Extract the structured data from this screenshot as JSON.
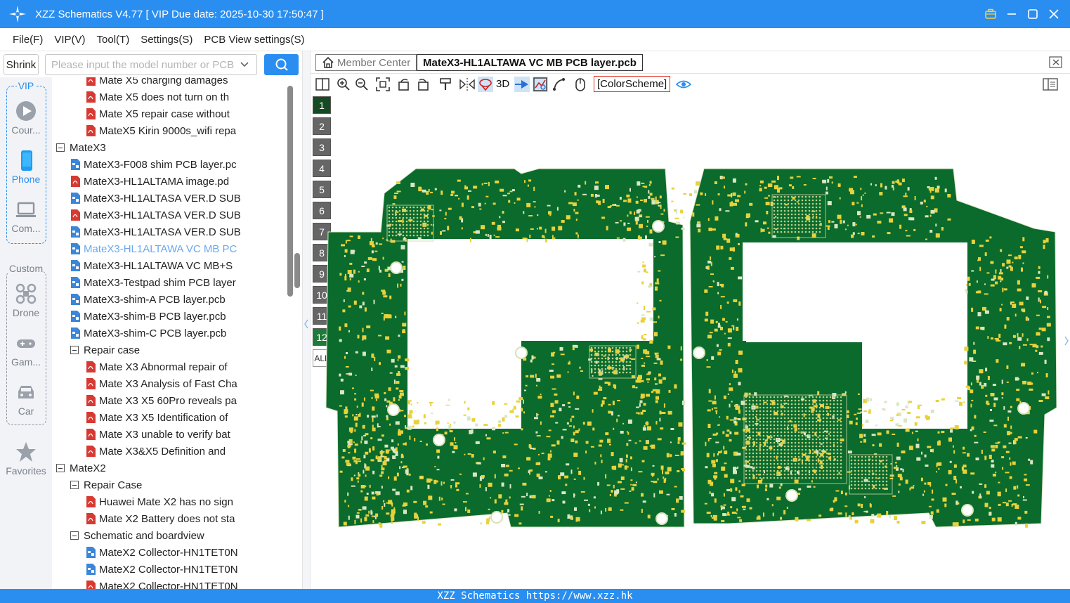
{
  "window": {
    "title": "XZZ Schematics V4.77 [ VIP Due date: 2025-10-30 17:50:47 ]"
  },
  "menu": [
    "File(F)",
    "VIP(V)",
    "Tool(T)",
    "Settings(S)",
    "PCB View settings(S)"
  ],
  "search": {
    "shrink_label": "Shrink",
    "placeholder": "Please input the model number or PCB"
  },
  "rail": {
    "vip_label": "VIP",
    "custom_label": "Custom",
    "items": [
      {
        "label": "Cour...",
        "icon": "play-icon"
      },
      {
        "label": "Phone",
        "icon": "phone-icon"
      },
      {
        "label": "Com...",
        "icon": "laptop-icon"
      },
      {
        "label": "Drone",
        "icon": "drone-icon"
      },
      {
        "label": "Gam...",
        "icon": "gamepad-icon"
      },
      {
        "label": "Car",
        "icon": "car-icon"
      },
      {
        "label": "Favorites",
        "icon": "star-icon"
      }
    ]
  },
  "tree": {
    "rows": [
      {
        "text": "Mate X5 charging damages",
        "icon": "pdf",
        "level": 2
      },
      {
        "text": "Mate X5 does not turn on th",
        "icon": "pdf",
        "level": 2
      },
      {
        "text": "Mate X5 repair case without",
        "icon": "pdf",
        "level": 2
      },
      {
        "text": "MateX5 Kirin 9000s_wifi repa",
        "icon": "pdf",
        "level": 2
      },
      {
        "text": "MateX3",
        "icon": "folder",
        "level": 0
      },
      {
        "text": "MateX3-F008 shim PCB layer.pc",
        "icon": "pcb",
        "level": 1
      },
      {
        "text": "MateX3-HL1ALTAMA image.pd",
        "icon": "pdf",
        "level": 1
      },
      {
        "text": "MateX3-HL1ALTASA VER.D SUB",
        "icon": "pcb",
        "level": 1
      },
      {
        "text": "MateX3-HL1ALTASA VER.D SUB",
        "icon": "pdf",
        "level": 1
      },
      {
        "text": "MateX3-HL1ALTASA VER.D SUB",
        "icon": "pcb",
        "level": 1
      },
      {
        "text": "MateX3-HL1ALTAWA VC MB PC",
        "icon": "pcb",
        "level": 1,
        "selected": true
      },
      {
        "text": "MateX3-HL1ALTAWA VC MB+S",
        "icon": "pcb",
        "level": 1
      },
      {
        "text": "MateX3-Testpad shim PCB layer",
        "icon": "pcb",
        "level": 1
      },
      {
        "text": "MateX3-shim-A PCB layer.pcb",
        "icon": "pcb",
        "level": 1
      },
      {
        "text": "MateX3-shim-B PCB layer.pcb",
        "icon": "pcb",
        "level": 1
      },
      {
        "text": "MateX3-shim-C PCB layer.pcb",
        "icon": "pcb",
        "level": 1
      },
      {
        "text": "Repair case",
        "icon": "folder",
        "level": 1
      },
      {
        "text": "Mate X3 Abnormal repair of",
        "icon": "pdf",
        "level": 2
      },
      {
        "text": "Mate X3 Analysis of Fast Cha",
        "icon": "pdf",
        "level": 2
      },
      {
        "text": "Mate X3 X5 60Pro reveals pa",
        "icon": "pdf",
        "level": 2
      },
      {
        "text": "Mate X3 X5 Identification of",
        "icon": "pdf",
        "level": 2
      },
      {
        "text": "Mate X3 unable to verify bat",
        "icon": "pdf",
        "level": 2
      },
      {
        "text": "Mate X3&X5 Definition and",
        "icon": "pdf",
        "level": 2
      },
      {
        "text": "MateX2",
        "icon": "folder",
        "level": 0
      },
      {
        "text": "Repair Case",
        "icon": "folder",
        "level": 1
      },
      {
        "text": "Huawei Mate X2 has no sign",
        "icon": "pdf",
        "level": 2
      },
      {
        "text": "Mate X2 Battery does not sta",
        "icon": "pdf",
        "level": 2
      },
      {
        "text": "Schematic and boardview",
        "icon": "folder",
        "level": 1
      },
      {
        "text": "MateX2 Collector-HN1TET0N",
        "icon": "pcb",
        "level": 2
      },
      {
        "text": "MateX2 Collector-HN1TET0N",
        "icon": "pcb",
        "level": 2
      },
      {
        "text": "MateX2 Collector-HN1TET0N",
        "icon": "pdf",
        "level": 2
      }
    ]
  },
  "tabs": {
    "member_center": "Member Center",
    "active_file": "MateX3-HL1ALTAWA VC MB PCB layer.pcb"
  },
  "toolbar": {
    "three_d": "3D",
    "color_scheme": "[ColorScheme]"
  },
  "layers": [
    "1",
    "2",
    "3",
    "4",
    "5",
    "6",
    "7",
    "8",
    "9",
    "10",
    "11",
    "12",
    "ALL"
  ],
  "status": "XZZ Schematics https://www.xzz.hk",
  "colors": {
    "accent": "#2a8ef0",
    "pcb_green": "#0b6b2c",
    "pcb_pad": "#e8d23c"
  }
}
